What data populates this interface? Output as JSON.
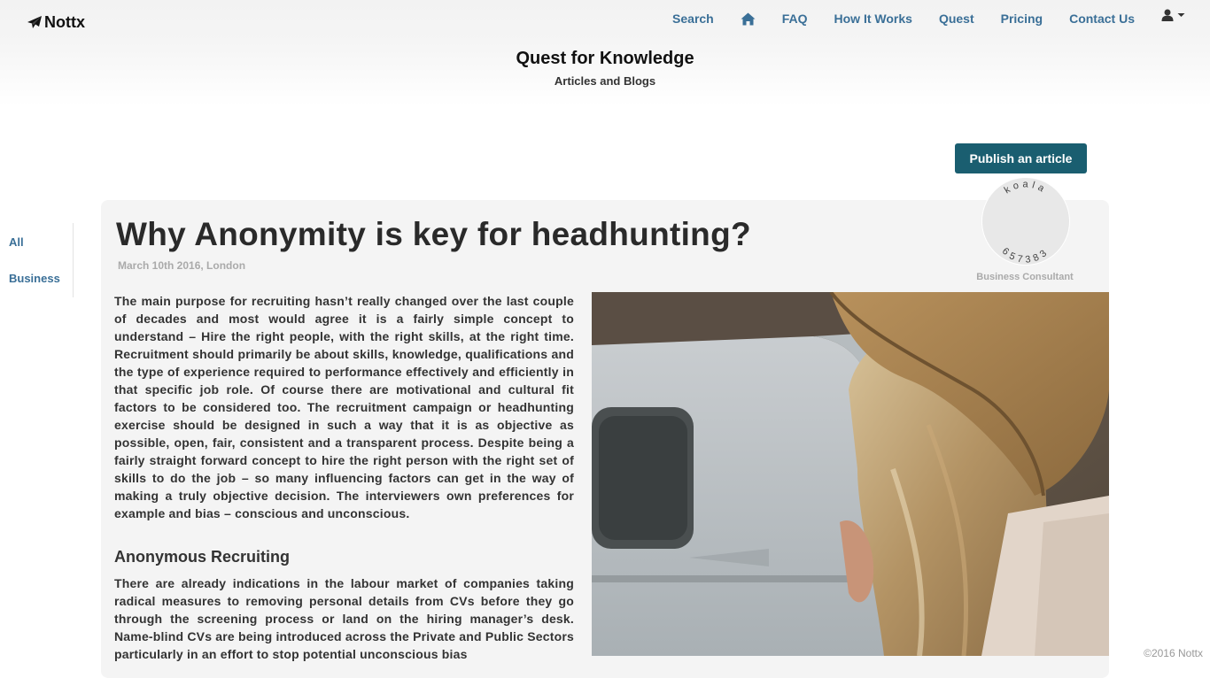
{
  "brand": {
    "name": "Nottx",
    "icon": "paper-plane-icon"
  },
  "nav": {
    "search": "Search",
    "home_icon": "home-icon",
    "faq": "FAQ",
    "how_it_works": "How It Works",
    "quest": "Quest",
    "pricing": "Pricing",
    "contact": "Contact Us",
    "user_icon": "user-icon"
  },
  "header": {
    "title": "Quest for Knowledge",
    "subtitle": "Articles and Blogs"
  },
  "actions": {
    "publish": "Publish an article"
  },
  "sidebar": {
    "categories": [
      {
        "label": "All"
      },
      {
        "label": "Business"
      }
    ]
  },
  "article": {
    "title": "Why Anonymity is key for headhunting?",
    "meta": "March 10th 2016, London",
    "author": {
      "top": "koala",
      "bottom": "657383",
      "role": "Business Consultant"
    },
    "paragraph1": "The main purpose for recruiting hasn’t really changed over the last couple of decades and most would agree it is a fairly simple concept to understand – Hire the right people, with the right skills, at the right time. Recruitment should primarily be about skills, knowledge, qualifications and the type of experience required to performance effectively and efficiently in that specific job role. Of course there are motivational and cultural fit factors to be considered too. The recruitment campaign or headhunting exercise should be designed in such a way that it is as objective as possible, open, fair, consistent and a transparent process. Despite being a fairly straight forward concept to hire the right person with the right set of skills to do the job – so many influencing factors can get in the way of making a truly objective decision. The interviewers own preferences for example and bias – conscious and unconscious.",
    "section_heading": "Anonymous Recruiting",
    "paragraph2": "There are already indications in the labour market of companies taking radical measures to removing personal details from CVs before they go through the screening process or land on the hiring manager’s desk. Name-blind CVs are being introduced across the Private and Public Sectors particularly in an effort to stop potential unconscious bias"
  },
  "footer": {
    "copyright": "©2016 Nottx"
  },
  "colors": {
    "nav_link": "#3a6f97",
    "button": "#1a5e70",
    "card": "#f4f4f4"
  }
}
